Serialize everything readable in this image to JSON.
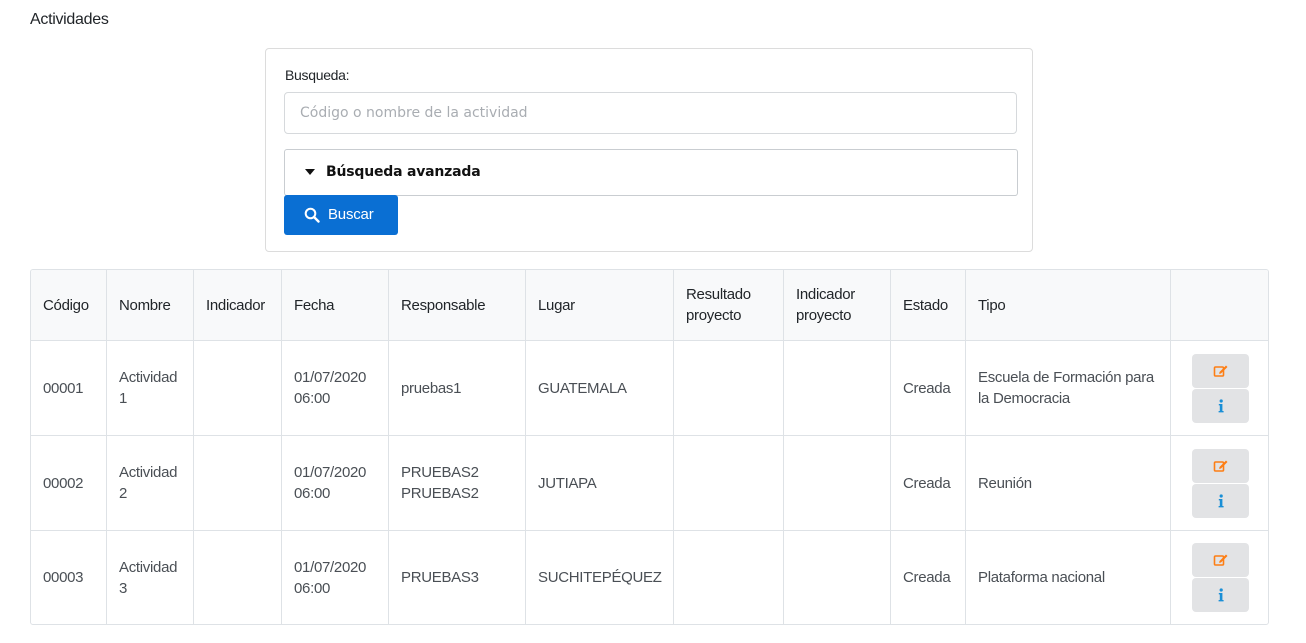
{
  "page": {
    "title": "Actividades"
  },
  "search": {
    "label": "Busqueda:",
    "placeholder": "Código o nombre de la actividad",
    "value": "",
    "advanced_label": "Búsqueda avanzada",
    "button_label": "Buscar",
    "button_color": "#0a6fd3"
  },
  "table": {
    "headers": {
      "codigo": "Código",
      "nombre": "Nombre",
      "indicador": "Indicador",
      "fecha": "Fecha",
      "responsable": "Responsable",
      "lugar": "Lugar",
      "resultado": "Resultado proyecto",
      "indicador_proyecto": "Indicador proyecto",
      "estado": "Estado",
      "tipo": "Tipo"
    },
    "rows": [
      {
        "codigo": "00001",
        "nombre": "Actividad 1",
        "indicador": "",
        "fecha": "01/07/2020 06:00",
        "responsable": "pruebas1",
        "lugar": "GUATEMALA",
        "resultado": "",
        "indicador_proyecto": "",
        "estado": "Creada",
        "tipo": "Escuela de Formación para la Democracia"
      },
      {
        "codigo": "00002",
        "nombre": "Actividad 2",
        "indicador": "",
        "fecha": "01/07/2020 06:00",
        "responsable": "PRUEBAS2 PRUEBAS2",
        "lugar": "JUTIAPA",
        "resultado": "",
        "indicador_proyecto": "",
        "estado": "Creada",
        "tipo": "Reunión"
      },
      {
        "codigo": "00003",
        "nombre": "Actividad 3",
        "indicador": "",
        "fecha": "01/07/2020 06:00",
        "responsable": "PRUEBAS3",
        "lugar": "SUCHITEPÉQUEZ",
        "resultado": "",
        "indicador_proyecto": "",
        "estado": "Creada",
        "tipo": "Plataforma nacional"
      }
    ],
    "actions": {
      "edit_icon": "edit-icon",
      "edit_color": "#fd7e14",
      "info_icon": "info-icon",
      "info_color": "#1a8fd6"
    }
  }
}
